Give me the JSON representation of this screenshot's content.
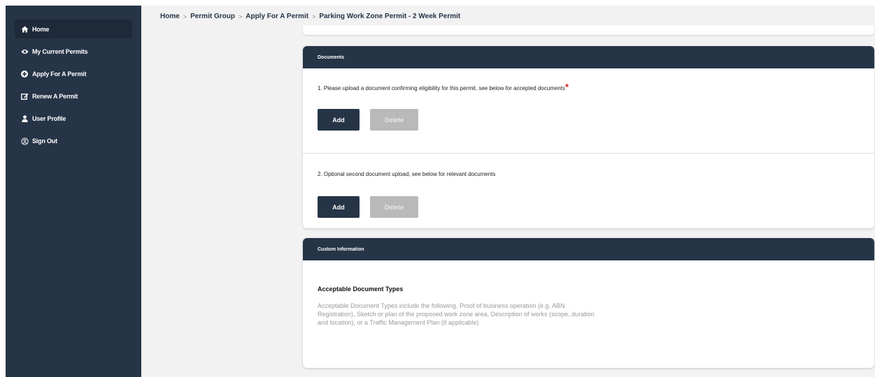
{
  "sidebar": {
    "items": [
      {
        "label": "Home",
        "icon": "home-icon",
        "active": true
      },
      {
        "label": "My Current Permits",
        "icon": "eye-icon",
        "active": false
      },
      {
        "label": "Apply For A Permit",
        "icon": "plus-circle-icon",
        "active": false
      },
      {
        "label": "Renew A Permit",
        "icon": "edit-icon",
        "active": false
      },
      {
        "label": "User Profile",
        "icon": "user-icon",
        "active": false
      },
      {
        "label": "Sign Out",
        "icon": "sign-out-icon",
        "active": false
      }
    ]
  },
  "breadcrumb": {
    "items": [
      "Home",
      "Permit Group",
      "Apply For A Permit",
      "Parking Work Zone Permit - 2 Week Permit"
    ],
    "separator": ">"
  },
  "documents": {
    "header": "Documents",
    "doc1": {
      "label": "1. Please upload a document confirming eligibility for this permit, see below for accepted documents",
      "required_mark": "*",
      "add_label": "Add",
      "delete_label": "Delete"
    },
    "doc2": {
      "label": "2. Optional second document upload, see below for relevant documents",
      "add_label": "Add",
      "delete_label": "Delete"
    }
  },
  "custom_info": {
    "header": "Custom Information",
    "title": "Acceptable Document Types",
    "text": "Acceptable Document Types include the following. Proof of business operation (e.g. ABN Registration), Sketch or plan of the proposed work zone area, Description of works (scope, duration and location), or a Traffic Management Plan (if applicable)"
  },
  "colors": {
    "sidebar_bg": "#263447",
    "primary_button": "#263447",
    "disabled_button": "#b9b9b9",
    "required": "#e02020"
  }
}
